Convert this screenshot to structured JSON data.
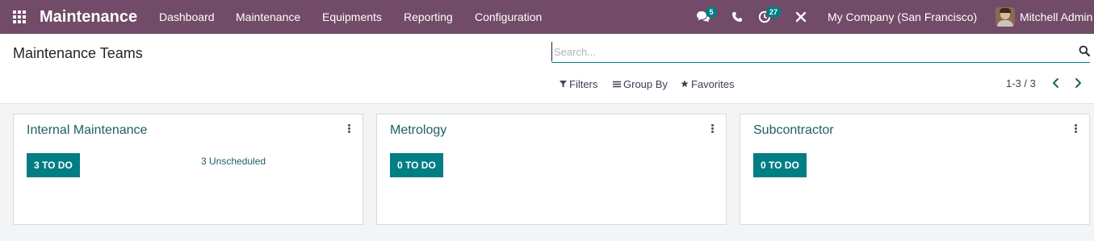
{
  "navbar": {
    "brand": "Maintenance",
    "menu": [
      "Dashboard",
      "Maintenance",
      "Equipments",
      "Reporting",
      "Configuration"
    ],
    "chat_count": "5",
    "activity_count": "27",
    "company": "My Company (San Francisco)",
    "user": "Mitchell Admin",
    "icons": [
      "apps-icon",
      "chat-icon",
      "phone-icon",
      "activity-icon",
      "debug-icon"
    ],
    "accent_color": "#714b67"
  },
  "control_panel": {
    "title": "Maintenance Teams",
    "search_placeholder": "Search...",
    "filters_label": "Filters",
    "groupby_label": "Group By",
    "favorites_label": "Favorites",
    "pager": "1-3 / 3"
  },
  "teams": [
    {
      "name": "Internal Maintenance",
      "todo_label": "3 TO DO",
      "unscheduled": "3 Unscheduled"
    },
    {
      "name": "Metrology",
      "todo_label": "0 TO DO"
    },
    {
      "name": "Subcontractor",
      "todo_label": "0 TO DO"
    }
  ],
  "colors": {
    "primary": "#017e84",
    "navbar": "#714b67"
  }
}
